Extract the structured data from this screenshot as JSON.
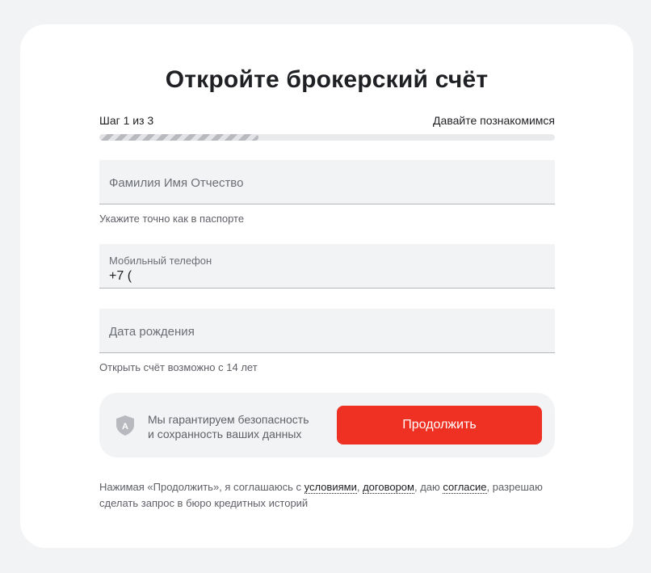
{
  "title": "Откройте брокерский счёт",
  "step": {
    "label": "Шаг 1 из 3",
    "name": "Давайте познакомимся",
    "progress_percent": 35
  },
  "fields": {
    "fio": {
      "placeholder": "Фамилия Имя Отчество",
      "hint": "Укажите точно как в паспорте"
    },
    "phone": {
      "label": "Мобильный телефон",
      "value": "+7 ("
    },
    "birthdate": {
      "placeholder": "Дата рождения",
      "hint": "Открыть счёт возможно с 14 лет"
    }
  },
  "security": {
    "icon": "shield-icon",
    "line1": "Мы гарантируем безопасность",
    "line2": "и сохранность ваших данных"
  },
  "continue_button": "Продолжить",
  "legal": {
    "prefix": "Нажимая «Продолжить», я соглашаюсь с ",
    "link_terms": "условиями",
    "sep1": ", ",
    "link_contract": "договором",
    "sep2": ", даю ",
    "link_consent": "согласие",
    "suffix": ", разрешаю сделать запрос в бюро кредитных историй"
  },
  "colors": {
    "accent": "#ef3124",
    "background": "#f2f3f5",
    "card": "#ffffff"
  }
}
